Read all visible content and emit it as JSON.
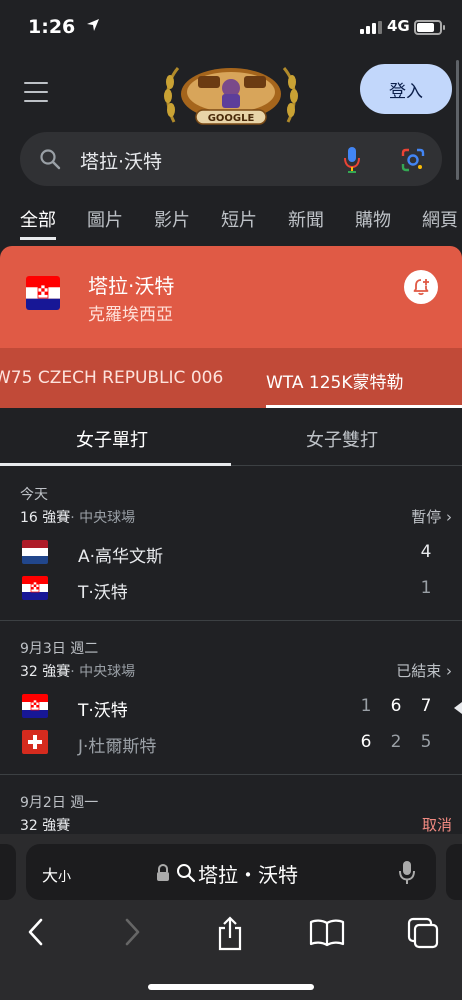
{
  "status_bar": {
    "time": "1:26",
    "network": "4G"
  },
  "header": {
    "login_label": "登入"
  },
  "search": {
    "query": "塔拉·沃特"
  },
  "tabs": [
    "全部",
    "圖片",
    "影片",
    "短片",
    "新聞",
    "購物",
    "網頁"
  ],
  "entity": {
    "name": "塔拉·沃特",
    "country": "克羅埃西亞"
  },
  "tournaments": [
    "W75 CZECH REPUBLIC 006",
    "WTA 125K蒙特勒"
  ],
  "subtabs": [
    "女子單打",
    "女子雙打"
  ],
  "matches": [
    {
      "date": "今天",
      "round": "16 強賽",
      "court": "· 中央球場",
      "status": "暫停",
      "players": [
        {
          "flag": "netherlands",
          "name": "A·高华文斯",
          "scores": [
            "4"
          ]
        },
        {
          "flag": "croatia",
          "name": "T·沃特",
          "scores": [
            "1"
          ]
        }
      ]
    },
    {
      "date": "9月3日 週二",
      "round": "32 強賽",
      "court": "· 中央球場",
      "status": "已結束",
      "players": [
        {
          "flag": "croatia",
          "name": "T·沃特",
          "scores": [
            "1",
            "6",
            "7"
          ]
        },
        {
          "flag": "switzerland",
          "name": "J·杜爾斯特",
          "scores": [
            "6",
            "2",
            "5"
          ]
        }
      ]
    },
    {
      "date": "9月2日 週一",
      "round": "32 強賽",
      "status": "取消"
    }
  ],
  "browser": {
    "text_size": "大",
    "text_size_small": "小",
    "url": "塔拉・沃特"
  },
  "colors": {
    "accent": "#e05a45",
    "login_bg": "#c2d7fb"
  }
}
